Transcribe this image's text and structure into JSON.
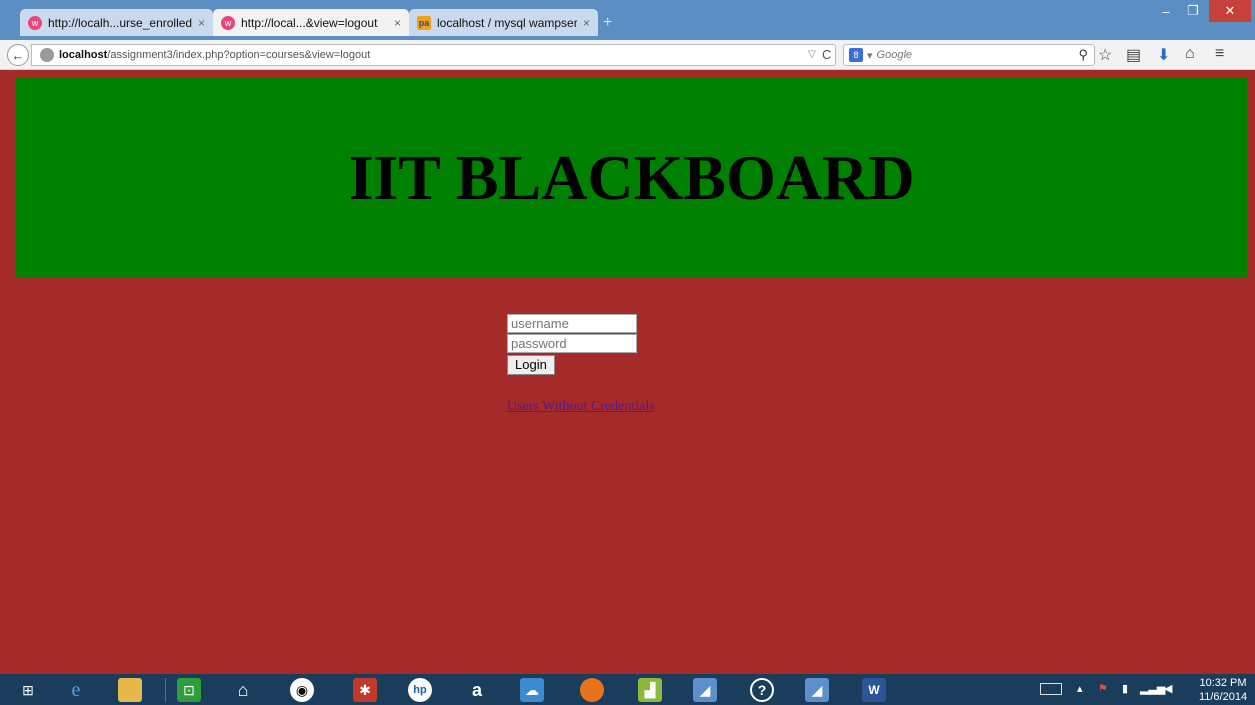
{
  "browser": {
    "tabs": [
      {
        "label": "http://localh...urse_enrolled",
        "close": "×",
        "favicon": "wamp-icon"
      },
      {
        "label": "http://local...&view=logout",
        "close": "×",
        "favicon": "wamp-icon"
      },
      {
        "label": "localhost / mysql wampser...",
        "close": "×",
        "favicon": "phpmyadmin-icon"
      }
    ],
    "new_tab": "+",
    "url_host": "localhost",
    "url_path": "/assignment3/index.php?option=courses&view=logout",
    "search_placeholder": "Google",
    "search_engine_glyph": "8",
    "reload_glyph": "C"
  },
  "page": {
    "title": "IIT BLACKBOARD",
    "username_placeholder": "username",
    "password_placeholder": "password",
    "login_label": "Login",
    "users_link": "Users Without Credentials"
  },
  "colors": {
    "page_bg": "#a52a2a",
    "header_bg": "#008000",
    "link": "#551a8b"
  },
  "taskbar": {
    "icons": [
      "windows-start-icon",
      "internet-explorer-icon",
      "file-explorer-icon",
      "store-icon",
      "home-icon",
      "camera-app-icon",
      "photos-app-icon",
      "hp-icon",
      "amazon-icon",
      "cloud-app-icon",
      "firefox-icon",
      "chart-app-icon",
      "app-icon",
      "help-icon",
      "app-icon-2",
      "word-icon"
    ],
    "amazon_glyph": "a",
    "hp_glyph": "hp",
    "help_glyph": "?",
    "time": "10:32 PM",
    "date": "11/6/2014"
  }
}
